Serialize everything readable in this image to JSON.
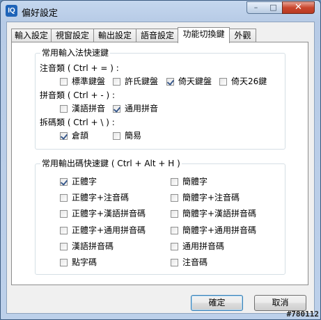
{
  "window": {
    "title": "偏好設定",
    "app_icon_text": "IQ",
    "min_glyph": "–",
    "max_glyph": "□",
    "close_glyph": "✕"
  },
  "tabs": [
    {
      "label": "輸入設定",
      "active": false
    },
    {
      "label": "視窗設定",
      "active": false
    },
    {
      "label": "輸出設定",
      "active": false
    },
    {
      "label": "語音設定",
      "active": false
    },
    {
      "label": "功能切換鍵",
      "active": true
    },
    {
      "label": "外觀",
      "active": false
    }
  ],
  "input_group": {
    "title": "常用輸入法快速鍵",
    "zhuyin": {
      "label": "注音類 ( Ctrl + = ) :",
      "options": [
        {
          "label": "標準鍵盤",
          "checked": false
        },
        {
          "label": "許氏鍵盤",
          "checked": false
        },
        {
          "label": "倚天鍵盤",
          "checked": true
        },
        {
          "label": "倚天26鍵",
          "checked": false
        }
      ]
    },
    "pinyin": {
      "label": "拼音類 ( Ctrl + - ) :",
      "options": [
        {
          "label": "漢語拼音",
          "checked": false
        },
        {
          "label": "通用拼音",
          "checked": true
        }
      ]
    },
    "chaima": {
      "label": "拆碼類 ( Ctrl + \\ ) :",
      "options": [
        {
          "label": "倉頡",
          "checked": true
        },
        {
          "label": "簡易",
          "checked": false
        }
      ]
    }
  },
  "output_group": {
    "title": "常用輸出碼快速鍵 ( Ctrl + Alt + H )",
    "left": [
      {
        "label": "正體字",
        "checked": true
      },
      {
        "label": "正體字+注音碼",
        "checked": false
      },
      {
        "label": "正體字+漢語拼音碼",
        "checked": false
      },
      {
        "label": "正體字+通用拼音碼",
        "checked": false
      },
      {
        "label": "漢語拼音碼",
        "checked": false
      },
      {
        "label": "點字碼",
        "checked": false
      }
    ],
    "right": [
      {
        "label": "簡體字",
        "checked": false
      },
      {
        "label": "簡體字+注音碼",
        "checked": false
      },
      {
        "label": "簡體字+漢語拼音碼",
        "checked": false
      },
      {
        "label": "簡體字+通用拼音碼",
        "checked": false
      },
      {
        "label": "通用拼音碼",
        "checked": false
      },
      {
        "label": "注音碼",
        "checked": false
      }
    ]
  },
  "buttons": {
    "ok": "確定",
    "cancel": "取消"
  },
  "watermark": "#780112"
}
